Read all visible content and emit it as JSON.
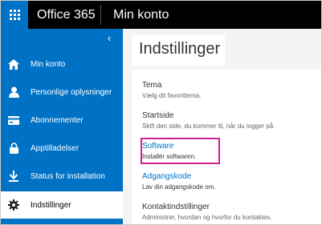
{
  "topbar": {
    "app_title": "Office 365",
    "page_name": "Min konto"
  },
  "sidebar": {
    "collapse_icon": "chevron-left-icon",
    "items": [
      {
        "label": "Min konto",
        "icon": "home-icon"
      },
      {
        "label": "Personlige oplysninger",
        "icon": "person-icon"
      },
      {
        "label": "Abonnementer",
        "icon": "credit-card-icon"
      },
      {
        "label": "Apptilladelser",
        "icon": "lock-icon"
      },
      {
        "label": "Status for installation",
        "icon": "download-icon"
      },
      {
        "label": "Indstillinger",
        "icon": "gear-icon",
        "active": true
      }
    ]
  },
  "main": {
    "title": "Indstillinger",
    "settings": [
      {
        "heading": "Tema",
        "description": "Vælg dit favorittema."
      },
      {
        "heading": "Startside",
        "description": "Skift den side, du kommer til, når du logger på."
      },
      {
        "heading": "Software",
        "description": "Installér softwaren.",
        "highlighted": true
      },
      {
        "heading": "Adgangskode",
        "description": "Lav din adgangskode om."
      },
      {
        "heading": "Kontaktindstillinger",
        "description": "Administrer, hvordan og hvorfor du kontaktes."
      }
    ]
  },
  "colors": {
    "brand_blue": "#0072c6",
    "topbar_black": "#000000",
    "highlight_magenta": "#d21f8c"
  }
}
